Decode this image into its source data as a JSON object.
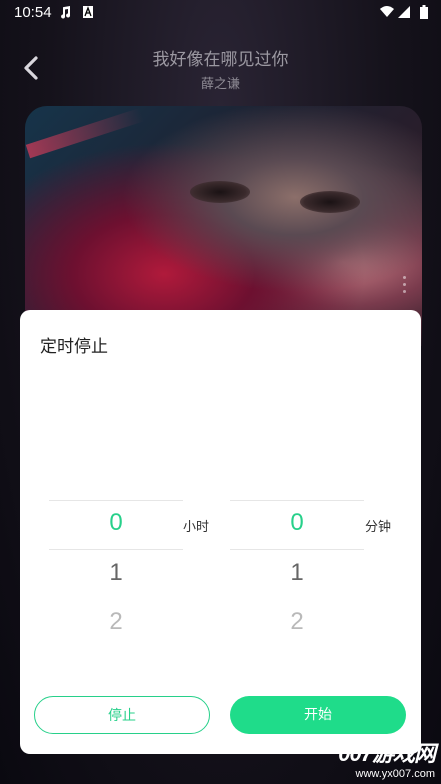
{
  "status_bar": {
    "time": "10:54",
    "icons": [
      "music-note-icon",
      "a-notification-icon",
      "wifi-icon",
      "signal-icon",
      "battery-icon"
    ]
  },
  "header": {
    "back_icon": "chevron-left-icon",
    "song_title": "我好像在哪见过你",
    "artist": "薛之谦"
  },
  "timer_sheet": {
    "title": "定时停止",
    "hours": {
      "unit": "小时",
      "values": [
        "0",
        "1",
        "2"
      ],
      "selected": "0"
    },
    "minutes": {
      "unit": "分钟",
      "values": [
        "0",
        "1",
        "2"
      ],
      "selected": "0"
    },
    "stop_label": "停止",
    "start_label": "开始"
  },
  "watermark": {
    "logo": "007游戏网",
    "url": "www.yx007.com"
  },
  "colors": {
    "accent": "#27d08a",
    "accent_fill": "#1fdc8a",
    "background": "#15121b",
    "sheet": "#ffffff"
  }
}
